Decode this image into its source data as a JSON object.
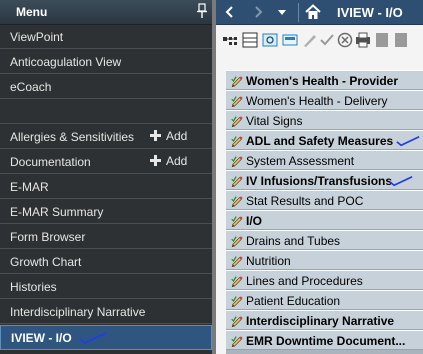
{
  "menu": {
    "title": "Menu",
    "items": [
      {
        "label": "ViewPoint"
      },
      {
        "label": "Anticoagulation View"
      },
      {
        "label": "eCoach"
      },
      {
        "label": "Allergies & Sensitivities",
        "action": "Add"
      },
      {
        "label": "Documentation",
        "action": "Add"
      },
      {
        "label": "E-MAR"
      },
      {
        "label": "E-MAR Summary"
      },
      {
        "label": "Form Browser"
      },
      {
        "label": "Growth Chart"
      },
      {
        "label": "Histories"
      },
      {
        "label": "Interdisciplinary Narrative"
      },
      {
        "label": "IVIEW - I/O",
        "selected": true
      }
    ]
  },
  "panel": {
    "title": "IVIEW - I/O",
    "bands": [
      {
        "label": "Women's Health - Provider",
        "bold": true
      },
      {
        "label": "Women's Health - Delivery",
        "bold": false
      },
      {
        "label": "Vital Signs",
        "bold": false
      },
      {
        "label": "ADL and Safety Measures",
        "bold": true,
        "checked": true
      },
      {
        "label": "System Assessment",
        "bold": false
      },
      {
        "label": "IV Infusions/Transfusions",
        "bold": true,
        "checked": true
      },
      {
        "label": "Stat Results and POC",
        "bold": false
      },
      {
        "label": "I/O",
        "bold": true
      },
      {
        "label": "Drains and Tubes",
        "bold": false
      },
      {
        "label": "Nutrition",
        "bold": false
      },
      {
        "label": "Lines and Procedures",
        "bold": false
      },
      {
        "label": "Patient Education",
        "bold": false
      },
      {
        "label": "Interdisciplinary Narrative",
        "bold": true
      },
      {
        "label": "EMR Downtime Document...",
        "bold": true
      }
    ]
  },
  "colors": {
    "menu_bg": "#2d3133",
    "selected_bg": "#2f5680",
    "title_bar": "#2e4f72",
    "band_bg": "#c7d1d9",
    "check_mark": "#1f3fe0"
  }
}
